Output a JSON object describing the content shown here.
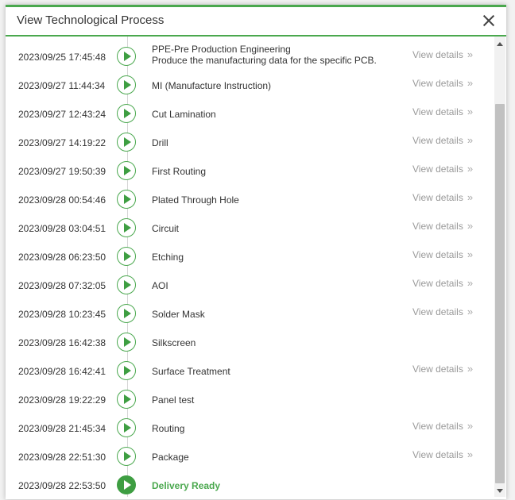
{
  "dialog": {
    "title": "View Technological Process",
    "view_details_label": "View details",
    "steps": [
      {
        "time": "2023/09/25 17:45:48",
        "name": "PPE-Pre Production Engineering",
        "description": "Produce the manufacturing data for the specific PCB.",
        "has_details": true
      },
      {
        "time": "2023/09/27 11:44:34",
        "name": "MI (Manufacture Instruction)",
        "has_details": true
      },
      {
        "time": "2023/09/27 12:43:24",
        "name": "Cut Lamination",
        "has_details": true
      },
      {
        "time": "2023/09/27 14:19:22",
        "name": "Drill",
        "has_details": true
      },
      {
        "time": "2023/09/27 19:50:39",
        "name": "First Routing",
        "has_details": true
      },
      {
        "time": "2023/09/28 00:54:46",
        "name": "Plated Through Hole",
        "has_details": true
      },
      {
        "time": "2023/09/28 03:04:51",
        "name": "Circuit",
        "has_details": true
      },
      {
        "time": "2023/09/28 06:23:50",
        "name": "Etching",
        "has_details": true
      },
      {
        "time": "2023/09/28 07:32:05",
        "name": "AOI",
        "has_details": true
      },
      {
        "time": "2023/09/28 10:23:45",
        "name": "Solder Mask",
        "has_details": true
      },
      {
        "time": "2023/09/28 16:42:38",
        "name": "Silkscreen",
        "has_details": false
      },
      {
        "time": "2023/09/28 16:42:41",
        "name": "Surface Treatment",
        "has_details": true
      },
      {
        "time": "2023/09/28 19:22:29",
        "name": "Panel test",
        "has_details": false
      },
      {
        "time": "2023/09/28 21:45:34",
        "name": "Routing",
        "has_details": true
      },
      {
        "time": "2023/09/28 22:51:30",
        "name": "Package",
        "has_details": true
      },
      {
        "time": "2023/09/28 22:53:50",
        "name": "Delivery Ready",
        "has_details": false,
        "final": true
      }
    ]
  },
  "colors": {
    "accent": "#4aa84e",
    "link": "#999999",
    "text": "#333333"
  }
}
